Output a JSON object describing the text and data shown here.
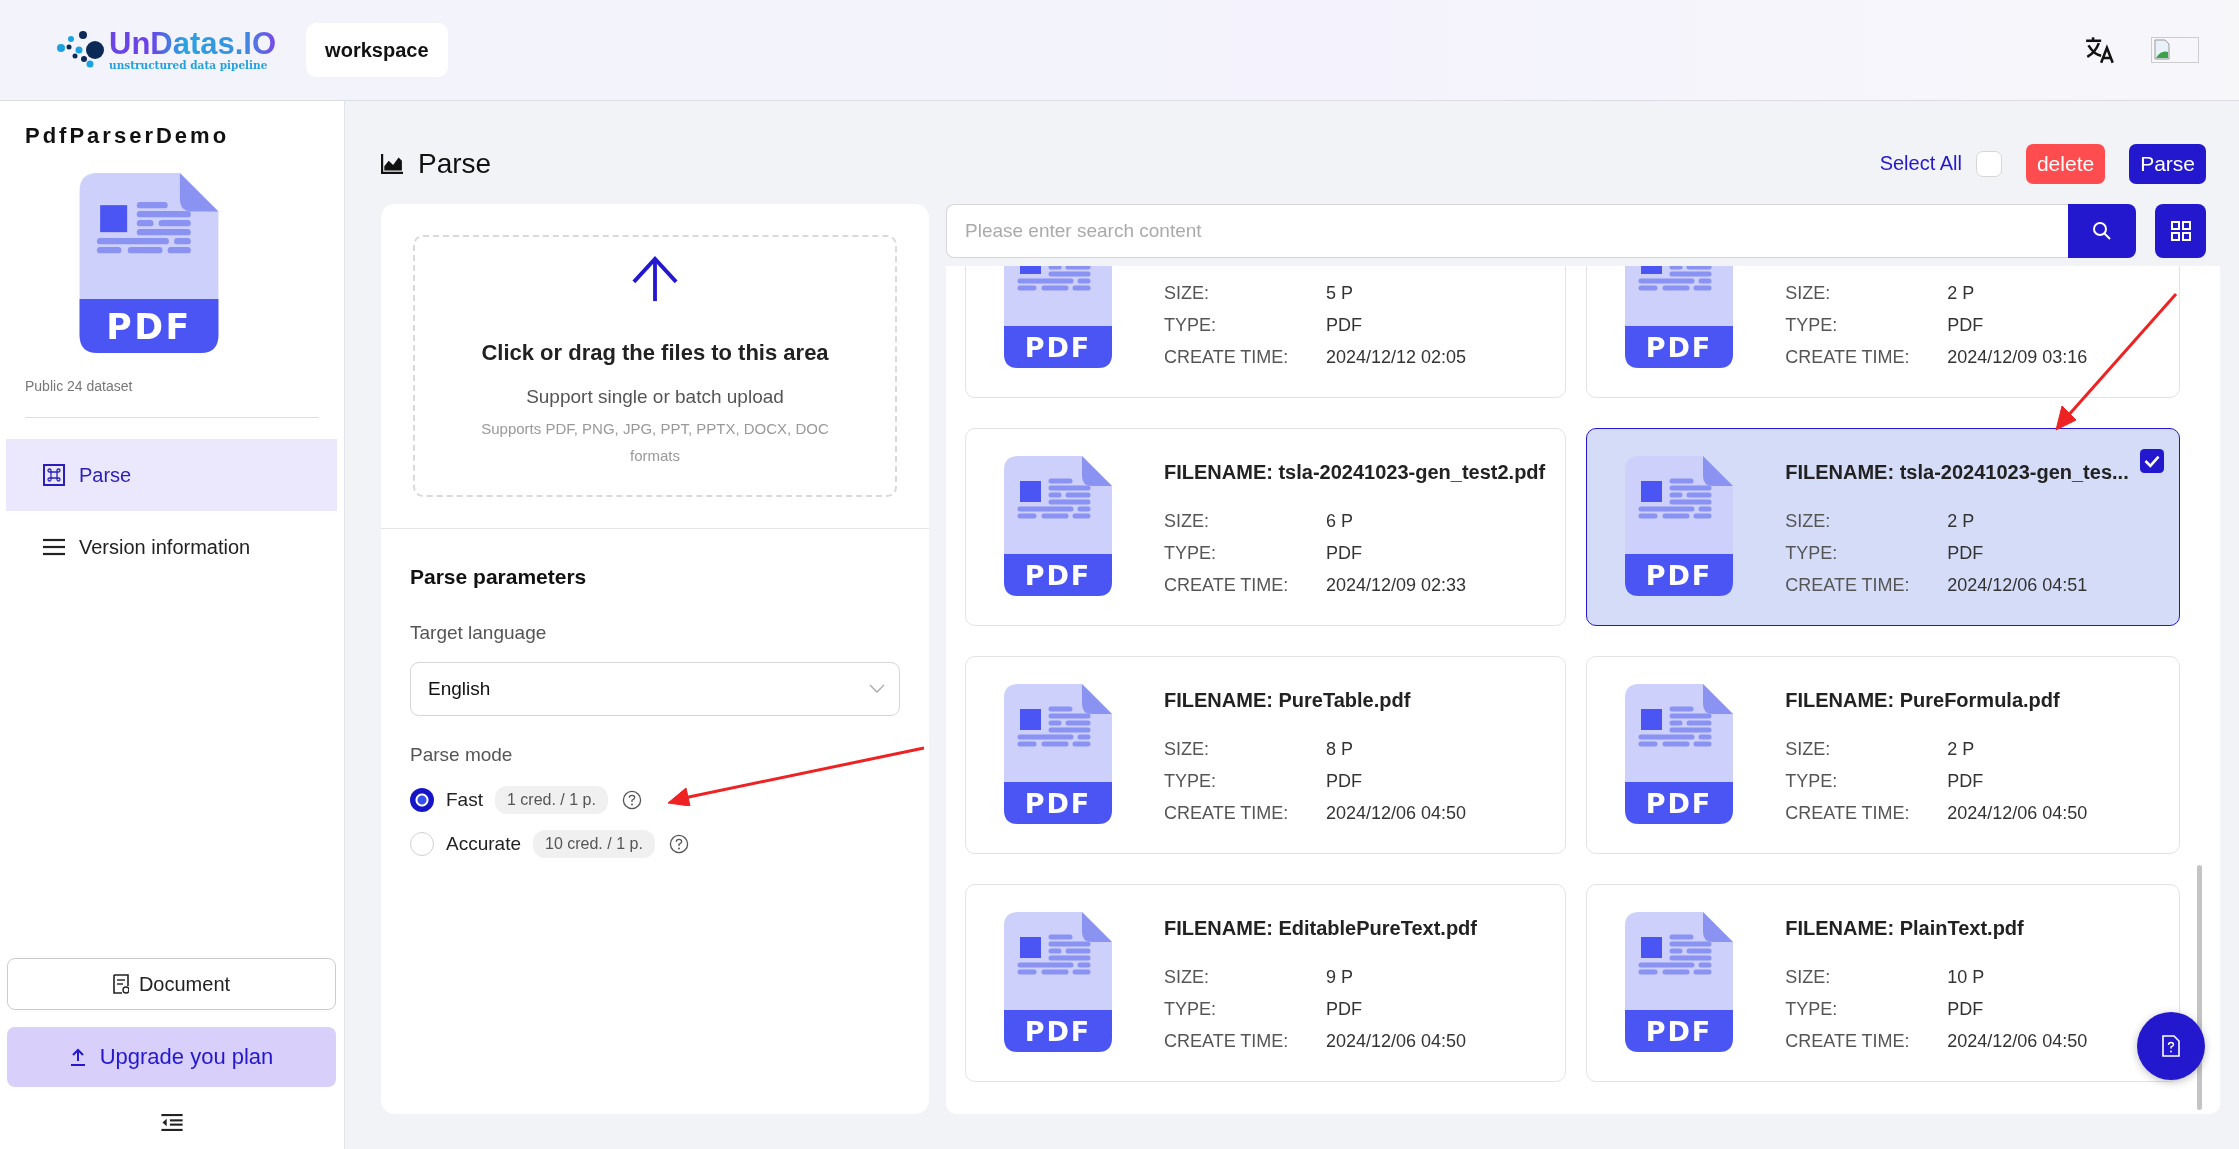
{
  "header": {
    "logo": {
      "name": "UnDatas.IO",
      "tagline": "unstructured data pipeline"
    },
    "workspace_tab": "workspace"
  },
  "sidebar": {
    "project": "PdfParserDemo",
    "project_icon_label": "PDF",
    "dataset": "Public 24 dataset",
    "nav": [
      {
        "label": "Parse",
        "kind": "command",
        "selected": true
      },
      {
        "label": "Version information",
        "kind": "menu",
        "selected": false
      }
    ],
    "document_button": "Document",
    "upgrade_button": "Upgrade you plan"
  },
  "page": {
    "title": "Parse",
    "select_all": {
      "label": "Select All",
      "checked": false
    },
    "delete_button": "delete",
    "parse_button": "Parse"
  },
  "upload": {
    "title": "Click or drag the files to this area",
    "hint": "Support single or batch upload",
    "formats": "Supports PDF, PNG, JPG, PPT, PPTX, DOCX, DOC formats"
  },
  "params": {
    "title": "Parse parameters",
    "language_label": "Target language",
    "language_value": "English",
    "mode_label": "Parse mode",
    "modes": [
      {
        "label": "Fast",
        "cost": "1 cred. / 1 p.",
        "selected": true
      },
      {
        "label": "Accurate",
        "cost": "10 cred. / 1 p.",
        "selected": false
      }
    ]
  },
  "search": {
    "placeholder": "Please enter search content"
  },
  "files": [
    {
      "icon_label": "PDF",
      "selected": false,
      "fields": [
        {
          "label": "SIZE:",
          "value": "5 P"
        },
        {
          "label": "TYPE:",
          "value": "PDF"
        },
        {
          "label": "CREATE TIME:",
          "value": "2024/12/12 02:05"
        }
      ]
    },
    {
      "icon_label": "PDF",
      "selected": false,
      "fields": [
        {
          "label": "SIZE:",
          "value": "2 P"
        },
        {
          "label": "TYPE:",
          "value": "PDF"
        },
        {
          "label": "CREATE TIME:",
          "value": "2024/12/09 03:16"
        }
      ]
    },
    {
      "filename": "FILENAME: tsla-20241023-gen_test2.pdf",
      "icon_label": "PDF",
      "selected": false,
      "fields": [
        {
          "label": "SIZE:",
          "value": "6 P"
        },
        {
          "label": "TYPE:",
          "value": "PDF"
        },
        {
          "label": "CREATE TIME:",
          "value": "2024/12/09 02:33"
        }
      ]
    },
    {
      "filename": "FILENAME: tsla-20241023-gen_tes...",
      "icon_label": "PDF",
      "selected": true,
      "fields": [
        {
          "label": "SIZE:",
          "value": "2 P"
        },
        {
          "label": "TYPE:",
          "value": "PDF"
        },
        {
          "label": "CREATE TIME:",
          "value": "2024/12/06 04:51"
        }
      ]
    },
    {
      "filename": "FILENAME: PureTable.pdf",
      "icon_label": "PDF",
      "selected": false,
      "fields": [
        {
          "label": "SIZE:",
          "value": "8 P"
        },
        {
          "label": "TYPE:",
          "value": "PDF"
        },
        {
          "label": "CREATE TIME:",
          "value": "2024/12/06 04:50"
        }
      ]
    },
    {
      "filename": "FILENAME: PureFormula.pdf",
      "icon_label": "PDF",
      "selected": false,
      "fields": [
        {
          "label": "SIZE:",
          "value": "2 P"
        },
        {
          "label": "TYPE:",
          "value": "PDF"
        },
        {
          "label": "CREATE TIME:",
          "value": "2024/12/06 04:50"
        }
      ]
    },
    {
      "filename": "FILENAME: EditablePureText.pdf",
      "icon_label": "PDF",
      "selected": false,
      "fields": [
        {
          "label": "SIZE:",
          "value": "9 P"
        },
        {
          "label": "TYPE:",
          "value": "PDF"
        },
        {
          "label": "CREATE TIME:",
          "value": "2024/12/06 04:50"
        }
      ]
    },
    {
      "filename": "FILENAME: PlainText.pdf",
      "icon_label": "PDF",
      "selected": false,
      "fields": [
        {
          "label": "SIZE:",
          "value": "10 P"
        },
        {
          "label": "TYPE:",
          "value": "PDF"
        },
        {
          "label": "CREATE TIME:",
          "value": "2024/12/06 04:50"
        }
      ]
    }
  ]
}
